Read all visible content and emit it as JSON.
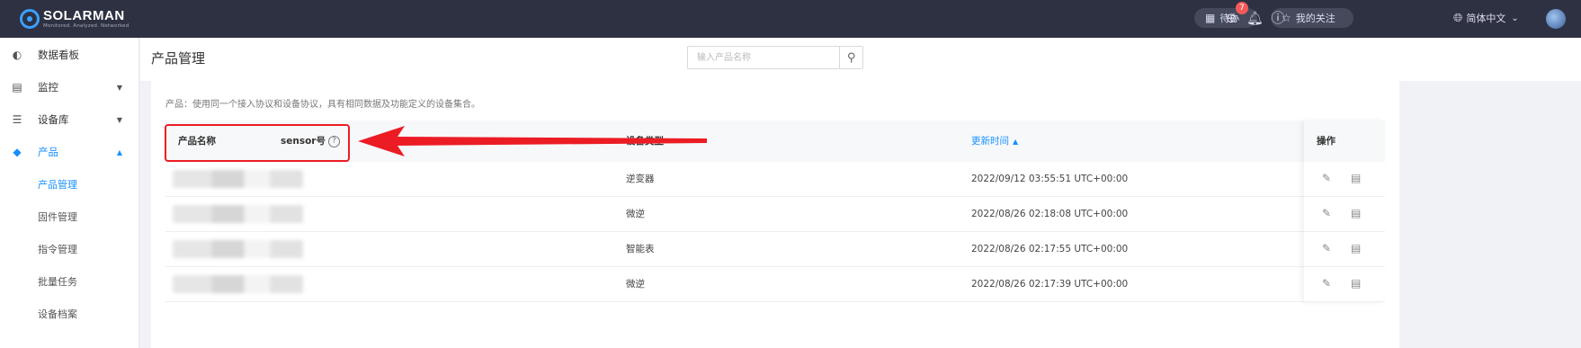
{
  "brand": {
    "name": "SOLARMAN",
    "tagline": "Monitored. Analyzed. Networked"
  },
  "topbar": {
    "todo_label": "待办",
    "todo_count": "7",
    "follow_label": "我的关注",
    "language": "简体中文"
  },
  "sidebar": {
    "items": [
      {
        "label": "数据看板"
      },
      {
        "label": "监控"
      },
      {
        "label": "设备库"
      },
      {
        "label": "产品"
      }
    ],
    "sub_items": [
      {
        "label": "产品管理"
      },
      {
        "label": "固件管理"
      },
      {
        "label": "指令管理"
      },
      {
        "label": "批量任务"
      },
      {
        "label": "设备档案"
      }
    ]
  },
  "page": {
    "title": "产品管理",
    "search_placeholder": "输入产品名称",
    "description": "产品：使用同一个接入协议和设备协议，具有相同数据及功能定义的设备集合。"
  },
  "table": {
    "columns": {
      "name": "产品名称",
      "sensor": "sensor号",
      "device_type": "设备类型",
      "updated": "更新时间",
      "actions": "操作"
    },
    "rows": [
      {
        "device_type": "逆变器",
        "updated": "2022/09/12 03:55:51 UTC+00:00"
      },
      {
        "device_type": "微逆",
        "updated": "2022/08/26 02:18:08 UTC+00:00"
      },
      {
        "device_type": "智能表",
        "updated": "2022/08/26 02:17:55 UTC+00:00"
      },
      {
        "device_type": "微逆",
        "updated": "2022/08/26 02:17:39 UTC+00:00"
      }
    ]
  },
  "colors": {
    "accent": "#1890ff",
    "topbar": "#2d3142",
    "annotation": "#ec1c24",
    "badge": "#f5595a"
  }
}
